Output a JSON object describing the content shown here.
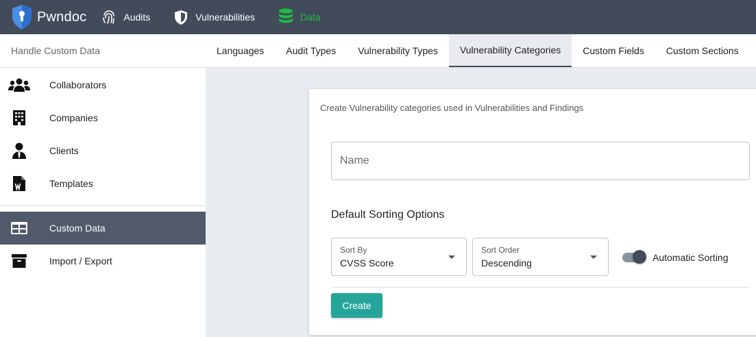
{
  "app": {
    "name": "Pwndoc"
  },
  "nav": [
    {
      "label": "Audits",
      "icon": "fingerprint-icon"
    },
    {
      "label": "Vulnerabilities",
      "icon": "shield-icon"
    },
    {
      "label": "Data",
      "icon": "database-icon",
      "active": true,
      "color": "#21ba45"
    }
  ],
  "subheader": {
    "title": "Handle Custom Data"
  },
  "tabs": [
    {
      "label": "Languages"
    },
    {
      "label": "Audit Types"
    },
    {
      "label": "Vulnerability Types"
    },
    {
      "label": "Vulnerability Categories",
      "active": true
    },
    {
      "label": "Custom Fields"
    },
    {
      "label": "Custom Sections"
    }
  ],
  "sidebar": {
    "items": [
      {
        "label": "Collaborators",
        "icon": "users-icon"
      },
      {
        "label": "Companies",
        "icon": "building-icon"
      },
      {
        "label": "Clients",
        "icon": "user-tie-icon"
      },
      {
        "label": "Templates",
        "icon": "word-file-icon"
      },
      {
        "label": "Custom Data",
        "icon": "table-icon",
        "active": true
      },
      {
        "label": "Import / Export",
        "icon": "archive-icon"
      }
    ]
  },
  "form": {
    "description": "Create Vulnerability categories used in Vulnerabilities and Findings",
    "name_placeholder": "Name",
    "name_value": "",
    "section_title": "Default Sorting Options",
    "sort_by": {
      "label": "Sort By",
      "value": "CVSS Score"
    },
    "sort_order": {
      "label": "Sort Order",
      "value": "Descending"
    },
    "auto_sort": {
      "label": "Automatic Sorting",
      "enabled": true
    },
    "create_label": "Create"
  },
  "colors": {
    "topbar": "#424b5a",
    "active_nav": "#21ba45",
    "sidebar_active": "#505a6a",
    "primary_button": "#26a69a"
  }
}
